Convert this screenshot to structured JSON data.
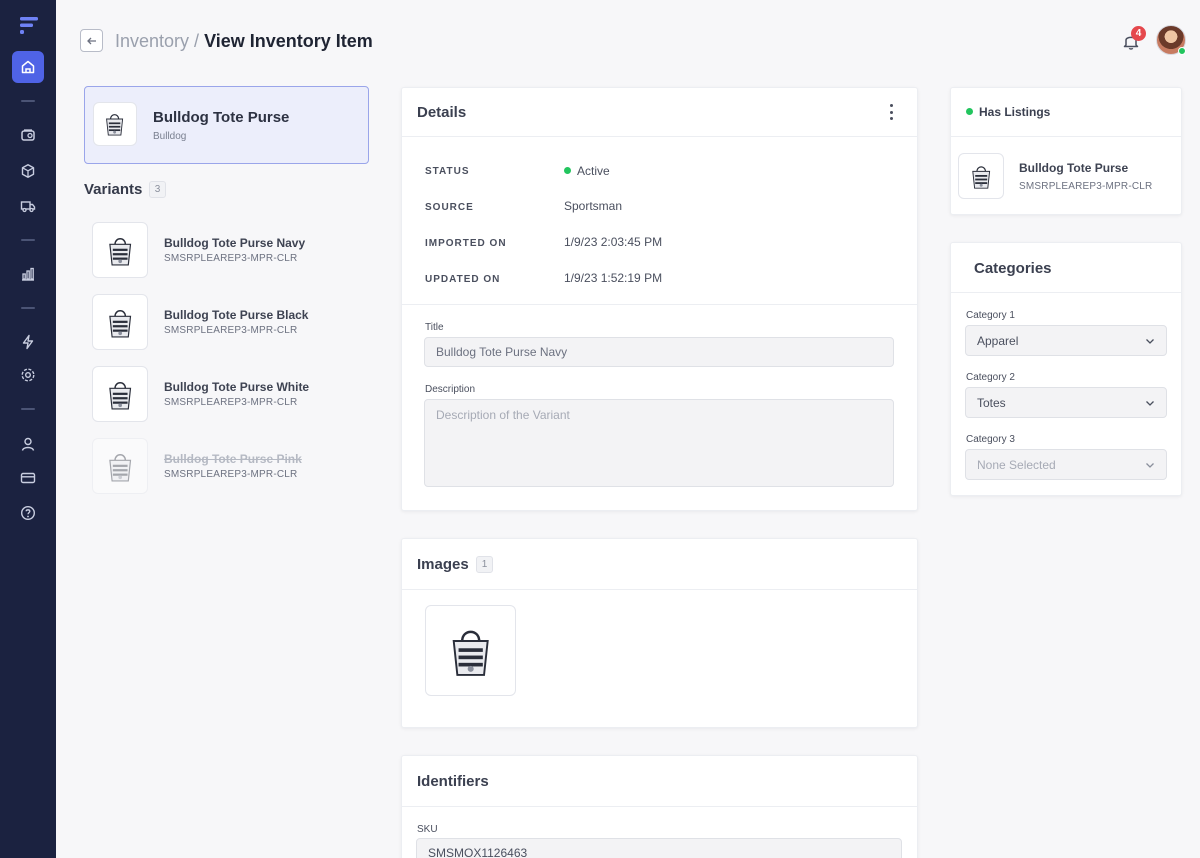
{
  "header": {
    "breadcrumb_parent": "Inventory",
    "breadcrumb_separator": " / ",
    "breadcrumb_current": "View Inventory Item",
    "notification_count": "4"
  },
  "sidebar": {
    "icons": [
      "home-icon",
      "tag-icon",
      "box-icon",
      "truck-icon",
      "bar-chart-icon",
      "bolt-icon",
      "settings-icon",
      "user-icon",
      "credit-card-icon",
      "help-icon"
    ]
  },
  "product": {
    "name": "Bulldog Tote Purse",
    "brand": "Bulldog"
  },
  "variants": {
    "label": "Variants",
    "count": "3",
    "items": [
      {
        "name": "Bulldog Tote Purse Navy",
        "sku": "SMSRPLEAREP3-MPR-CLR"
      },
      {
        "name": "Bulldog Tote Purse Black",
        "sku": "SMSRPLEAREP3-MPR-CLR"
      },
      {
        "name": "Bulldog Tote Purse White",
        "sku": "SMSRPLEAREP3-MPR-CLR"
      },
      {
        "name": "Bulldog Tote Purse Pink",
        "sku": "SMSRPLEAREP3-MPR-CLR"
      }
    ]
  },
  "details": {
    "title": "Details",
    "rows": [
      {
        "label": "STATUS",
        "value": "Active"
      },
      {
        "label": "SOURCE",
        "value": "Sportsman"
      },
      {
        "label": "IMPORTED ON",
        "value": "1/9/23 2:03:45 PM"
      },
      {
        "label": "UPDATED ON",
        "value": "1/9/23 1:52:19 PM"
      }
    ],
    "title_field_label": "Title",
    "title_field_value": "Bulldog Tote Purse Navy",
    "description_label": "Description",
    "description_placeholder": "Description of the Variant"
  },
  "images": {
    "title": "Images",
    "count": "1"
  },
  "identifiers": {
    "title": "Identifiers",
    "sku_label": "SKU",
    "sku_value": "SMSMOX1126463"
  },
  "listings": {
    "label": "Has Listings",
    "item_name": "Bulldog Tote Purse",
    "item_sku": "SMSRPLEAREP3-MPR-CLR"
  },
  "categories": {
    "title": "Categories",
    "fields": [
      {
        "label": "Category 1",
        "value": "Apparel"
      },
      {
        "label": "Category 2",
        "value": "Totes"
      },
      {
        "label": "Category 3",
        "value": "None Selected"
      }
    ]
  },
  "colors": {
    "sidebar_bg": "#1b2240",
    "accent": "#4f63e6",
    "status_active": "#22c55e",
    "badge_red": "#e5484d"
  }
}
